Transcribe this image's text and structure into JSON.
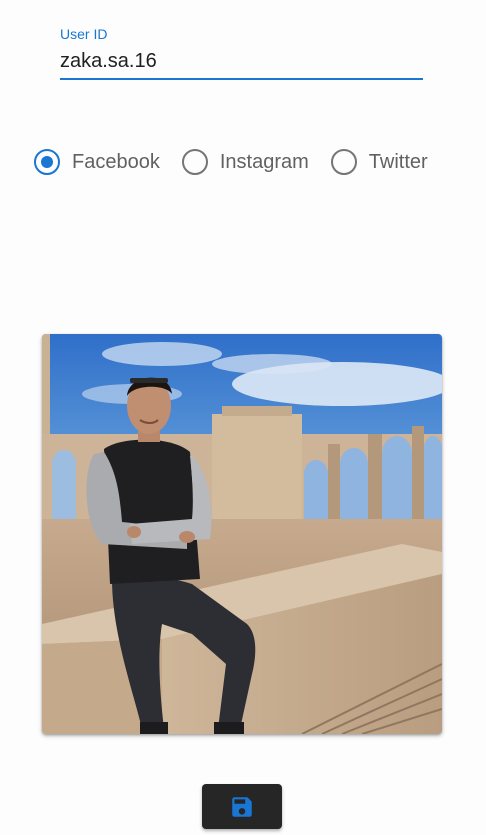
{
  "user_id_field": {
    "label": "User ID",
    "value": "zaka.sa.16"
  },
  "platform": {
    "options": [
      {
        "label": "Facebook",
        "checked": true
      },
      {
        "label": "Instagram",
        "checked": false
      },
      {
        "label": "Twitter",
        "checked": false
      }
    ]
  },
  "photo": {
    "icon": "profile-photo"
  },
  "save_button": {
    "icon": "floppy-disk-icon",
    "icon_color": "#1976d2"
  },
  "colors": {
    "accent": "#1976d2",
    "button_bg": "#262626"
  }
}
